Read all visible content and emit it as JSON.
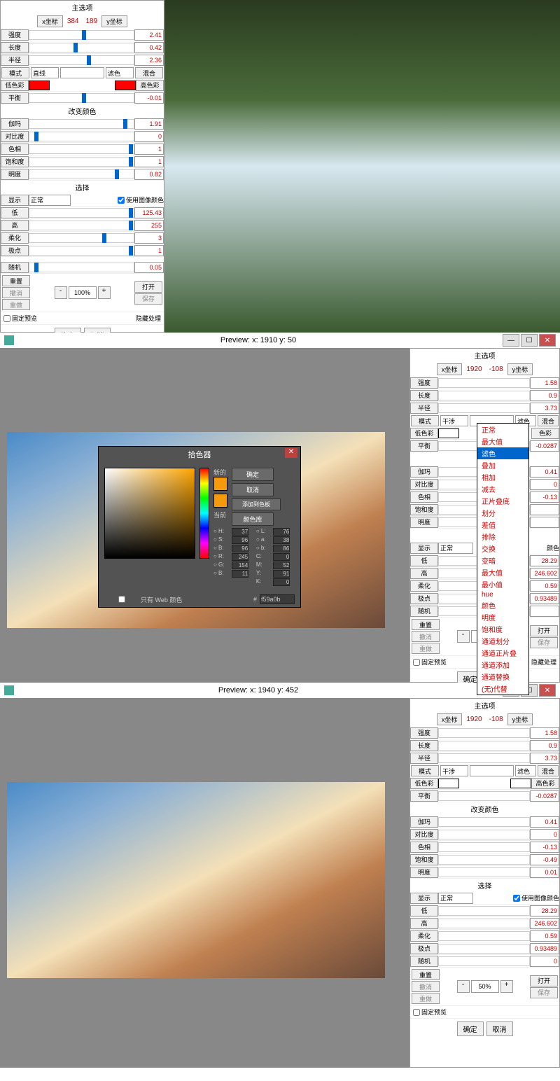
{
  "panel1": {
    "title": "主选项",
    "x_label": "x坐标",
    "x_val": "384",
    "y_val": "189",
    "y_label": "y坐标",
    "intensity": "强度",
    "intensity_val": "2.41",
    "length": "长度",
    "length_val": "0.42",
    "radius": "半径",
    "radius_val": "2.36",
    "mode": "模式",
    "mode_opt1": "直线",
    "mode_opt2": "滤色",
    "mode_mix": "混合",
    "low_color": "低色彩",
    "high_color": "高色彩",
    "balance": "平衡",
    "balance_val": "-0.01",
    "change_color": "改变颜色",
    "gamma": "伽玛",
    "gamma_val": "1.91",
    "contrast": "对比度",
    "contrast_val": "0",
    "hue": "色相",
    "hue_val": "1",
    "saturation": "饱和度",
    "saturation_val": "1",
    "brightness": "明度",
    "brightness_val": "0.82",
    "select": "选择",
    "display": "显示",
    "display_opt": "正常",
    "use_img_color": "使用图像颜色",
    "low": "低",
    "low_val": "125.43",
    "high": "高",
    "high_val": "255",
    "soften": "柔化",
    "soften_val": "3",
    "pole": "极点",
    "pole_val": "1",
    "random": "随机",
    "random_val": "0.05",
    "reset": "重置",
    "open": "打开",
    "undo": "撤消",
    "save": "保存",
    "redo": "重做",
    "zoom": "100%",
    "fixed_preview": "固定预览",
    "hide_process": "隐藏处理",
    "ok": "确定",
    "cancel": "取消"
  },
  "preview2": {
    "title": "Preview:  x: 1910 y: 50"
  },
  "panel2": {
    "title": "主选项",
    "x_label": "x坐标",
    "x_val": "1920",
    "y_val": "-108",
    "y_label": "y坐标",
    "intensity": "强度",
    "intensity_val": "1.58",
    "length": "长度",
    "length_val": "0.9",
    "radius": "半径",
    "radius_val": "3.73",
    "mode": "模式",
    "mode_opt1": "干涉",
    "mode_opt2": "滤色",
    "mode_mix": "混合",
    "low_color": "低色彩",
    "high_color": "色彩",
    "balance": "平衡",
    "balance_val": "-0.0287",
    "change_color": "改变",
    "gamma": "伽玛",
    "gamma_val": "0.41",
    "contrast": "对比度",
    "contrast_val": "0",
    "hue": "色相",
    "hue_val": "-0.13",
    "saturation": "饱和度",
    "brightness": "明度",
    "select": "选",
    "display": "显示",
    "display_opt": "正常",
    "use_img_color": "颜色",
    "low": "低",
    "low_val": "28.29",
    "high": "高",
    "high_val": "246.602",
    "soften": "柔化",
    "soften_val": "0.59",
    "pole": "极点",
    "pole_val": "0.93489",
    "random": "随机",
    "reset": "重置",
    "open": "打开",
    "undo": "撤消",
    "save": "保存",
    "redo": "重做",
    "zoom": "50%",
    "fixed_preview": "固定预览",
    "hide_process": "隐藏处理",
    "ok": "确定",
    "cancel": "取消"
  },
  "dropdown_options": [
    "正常",
    "最大值",
    "滤色",
    "叠加",
    "相加",
    "减去",
    "正片叠底",
    "划分",
    "差值",
    "排除",
    "交换",
    "变暗",
    "最大值",
    "最小值",
    "hue",
    "颜色",
    "明度",
    "饱和度",
    "通道划分",
    "通道正片叠",
    "通道添加",
    "通道替换",
    "(无)代替"
  ],
  "color_picker": {
    "title": "拾色器",
    "new": "新的",
    "current": "当前",
    "ok": "确定",
    "cancel": "取消",
    "add": "添加到色板",
    "lib": "颜色库",
    "web_only": "只有 Web 颜色",
    "H": "37",
    "S": "96",
    "B": "96",
    "R": "245",
    "G": "154",
    "B2": "11",
    "L": "76",
    "a": "38",
    "b": "86",
    "C": "0",
    "M": "52",
    "Y": "91",
    "K": "0",
    "hex": "f59a0b"
  },
  "preview3": {
    "title": "Preview:  x: 1940 y: 452"
  },
  "panel3": {
    "title": "主选项",
    "x_label": "x坐标",
    "x_val": "1920",
    "y_val": "-108",
    "y_label": "y坐标",
    "intensity": "强度",
    "intensity_val": "1.58",
    "length": "长度",
    "length_val": "0.9",
    "radius": "半径",
    "radius_val": "3.73",
    "mode": "模式",
    "mode_opt1": "干涉",
    "mode_opt2": "滤色",
    "mode_mix": "混合",
    "low_color": "低色彩",
    "high_color": "高色彩",
    "balance": "平衡",
    "balance_val": "-0.0287",
    "change_color": "改变颜色",
    "gamma": "伽玛",
    "gamma_val": "0.41",
    "contrast": "对比度",
    "contrast_val": "0",
    "hue": "色相",
    "hue_val": "-0.13",
    "saturation": "饱和度",
    "saturation_val": "-0.49",
    "brightness": "明度",
    "brightness_val": "0.01",
    "select": "选择",
    "display": "显示",
    "display_opt": "正常",
    "use_img_color": "使用图像颜色",
    "low": "低",
    "low_val": "28.29",
    "high": "高",
    "high_val": "246.602",
    "soften": "柔化",
    "soften_val": "0.59",
    "pole": "极点",
    "pole_val": "0.93489",
    "random": "随机",
    "random_val": "0",
    "reset": "重置",
    "open": "打开",
    "undo": "撤消",
    "save": "保存",
    "redo": "重做",
    "zoom": "50%",
    "fixed_preview": "固定预览",
    "ok": "确定",
    "cancel": "取消"
  }
}
